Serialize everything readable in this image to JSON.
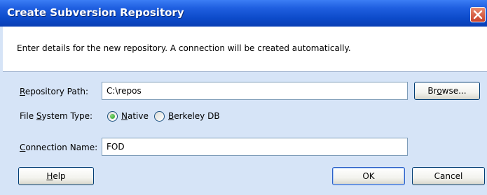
{
  "dialog": {
    "title": "Create Subversion Repository",
    "description": "Enter details for the new repository. A connection will be created automatically."
  },
  "form": {
    "repository_path": {
      "label_mnemonic": "R",
      "label_rest": "epository Path:",
      "value": "C:\\repos",
      "browse_pre": "Br",
      "browse_mnemonic": "o",
      "browse_post": "wse..."
    },
    "file_system_type": {
      "label_pre": "File ",
      "label_mnemonic": "S",
      "label_rest": "ystem Type:",
      "options": [
        {
          "mnemonic": "N",
          "rest": "ative",
          "selected": true
        },
        {
          "mnemonic": "B",
          "rest": "erkeley DB",
          "selected": false
        }
      ]
    },
    "connection_name": {
      "label_mnemonic": "C",
      "label_rest": "onnection Name:",
      "value": "FOD"
    }
  },
  "buttons": {
    "help_mnemonic": "H",
    "help_rest": "elp",
    "ok": "OK",
    "cancel": "Cancel"
  },
  "colors": {
    "titlebar": "#0c4ac9",
    "dialog_bg": "#d6e4f7",
    "close_button": "#c8412b",
    "radio_selected": "#21a121"
  },
  "icons": {
    "close": "close-icon"
  }
}
